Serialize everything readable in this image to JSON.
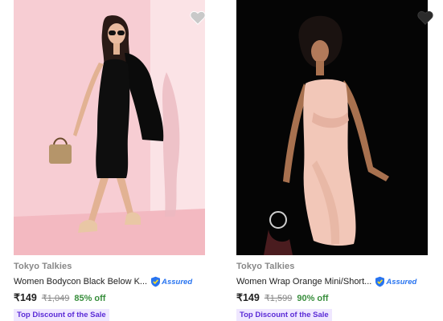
{
  "products": [
    {
      "brand": "Tokyo Talkies",
      "title": "Women Bodycon Black Below K...",
      "assured_label": "Assured",
      "price": "₹149",
      "mrp": "₹1,049",
      "discount": "85% off",
      "tag": "Top Discount of the Sale",
      "image_icon": "model-black-dress-photo",
      "wishlist_icon": "heart-icon"
    },
    {
      "brand": "Tokyo Talkies",
      "title": "Women Wrap Orange Mini/Short...",
      "assured_label": "Assured",
      "price": "₹149",
      "mrp": "₹1,599",
      "discount": "90% off",
      "tag": "Top Discount of the Sale",
      "image_icon": "model-satin-wrap-dress-photo",
      "wishlist_icon": "heart-icon"
    }
  ],
  "colors": {
    "price_green": "#388e3c",
    "tag_bg": "#efe7ff",
    "tag_text": "#5b2bd7",
    "assured_blue": "#2874f0"
  }
}
